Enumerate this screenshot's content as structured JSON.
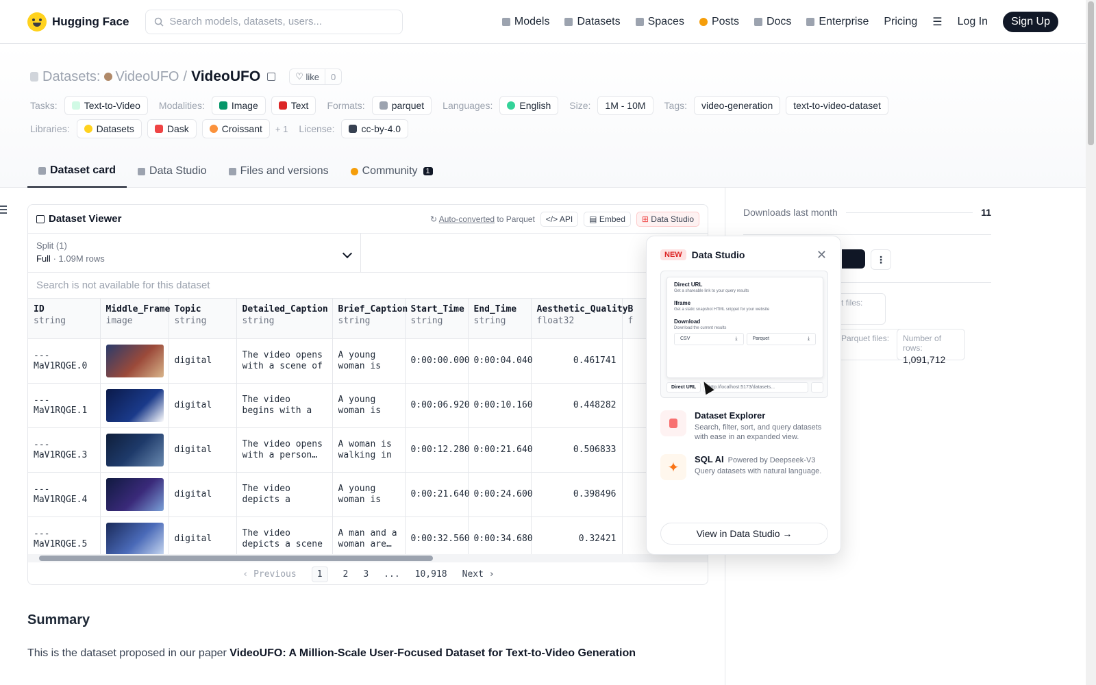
{
  "nav": {
    "brand": "Hugging Face",
    "search_placeholder": "Search models, datasets, users...",
    "links": [
      "Models",
      "Datasets",
      "Spaces",
      "Posts",
      "Docs",
      "Enterprise",
      "Pricing"
    ],
    "login": "Log In",
    "signup": "Sign Up"
  },
  "header": {
    "section_label": "Datasets:",
    "owner": "VideoUFO",
    "separator": "/",
    "name": "VideoUFO",
    "like_label": "like",
    "like_count": "0",
    "tasks_label": "Tasks:",
    "task": "Text-to-Video",
    "modalities_label": "Modalities:",
    "modality_image": "Image",
    "modality_text": "Text",
    "formats_label": "Formats:",
    "format": "parquet",
    "languages_label": "Languages:",
    "language": "English",
    "size_label": "Size:",
    "size": "1M - 10M",
    "tags_label": "Tags:",
    "tag1": "video-generation",
    "tag2": "text-to-video-dataset",
    "libraries_label": "Libraries:",
    "lib1": "Datasets",
    "lib2": "Dask",
    "lib3": "Croissant",
    "lib_more": "+ 1",
    "license_label": "License:",
    "license": "cc-by-4.0",
    "tabs": [
      {
        "label": "Dataset card"
      },
      {
        "label": "Data Studio"
      },
      {
        "label": "Files and versions"
      },
      {
        "label": "Community",
        "badge": "1"
      }
    ]
  },
  "viewer": {
    "title": "Dataset Viewer",
    "auto_converted": "Auto-converted",
    "to_parquet": "to Parquet",
    "api": "API",
    "embed": "Embed",
    "data_studio": "Data Studio",
    "split_label": "Split (1)",
    "split_name": "Full",
    "split_sep": "·",
    "split_rows": "1.09M rows",
    "search_disabled": "Search is not available for this dataset",
    "columns": [
      {
        "name": "ID",
        "type": "string"
      },
      {
        "name": "Middle_Frame",
        "type": "image"
      },
      {
        "name": "Topic",
        "type": "string"
      },
      {
        "name": "Detailed_Caption",
        "type": "string"
      },
      {
        "name": "Brief_Caption",
        "type": "string"
      },
      {
        "name": "Start_Time",
        "type": "string"
      },
      {
        "name": "End_Time",
        "type": "string"
      },
      {
        "name": "Aesthetic_Quality",
        "type": "float32"
      },
      {
        "name": "B",
        "type": "f"
      }
    ],
    "rows": [
      {
        "id": "---MaV1RQGE.0",
        "topic": "digital",
        "detailed": "The video opens with a scene of a…",
        "brief": "A young woman is sitting a…",
        "start": "0:00:00.000",
        "end": "0:00:04.040",
        "aq": "0.461741"
      },
      {
        "id": "---MaV1RQGE.1",
        "topic": "digital",
        "detailed": "The video begins with a person…",
        "brief": "A young woman is sitting a…",
        "start": "0:00:06.920",
        "end": "0:00:10.160",
        "aq": "0.448282"
      },
      {
        "id": "---MaV1RQGE.3",
        "topic": "digital",
        "detailed": "The video opens with a person…",
        "brief": "A woman is walking in a…",
        "start": "0:00:12.280",
        "end": "0:00:21.640",
        "aq": "0.506833"
      },
      {
        "id": "---MaV1RQGE.4",
        "topic": "digital",
        "detailed": "The video depicts a person standing…",
        "brief": "A young woman is walking i…",
        "start": "0:00:21.640",
        "end": "0:00:24.600",
        "aq": "0.398496"
      },
      {
        "id": "---MaV1RQGE.5",
        "topic": "digital",
        "detailed": "The video depicts a scene in a diml…",
        "brief": "A man and a woman are…",
        "start": "0:00:32.560",
        "end": "0:00:34.680",
        "aq": "0.32421"
      }
    ],
    "pager": {
      "previous": "Previous",
      "pages": [
        "1",
        "2",
        "3",
        "...",
        "10,918"
      ],
      "next": "Next"
    }
  },
  "summary": {
    "heading": "Summary",
    "text": "This is the dataset proposed in our paper ",
    "paper": "VideoUFO: A Million-Scale User-Focused Dataset for Text-to-Video Generation"
  },
  "sidebar": {
    "downloads_label": "Downloads last month",
    "downloads_value": "11",
    "partial_files_label": "t files:",
    "parquet_files_label": "Parquet files:",
    "rows_label": "Number of rows:",
    "rows_value": "1,091,712"
  },
  "popover": {
    "badge": "NEW",
    "title": "Data Studio",
    "preview": {
      "direct_url": "Direct URL",
      "direct_url_desc": "Get a shareable link to your query results",
      "iframe": "Iframe",
      "iframe_desc": "Get a static snapshot HTML snippet for your website",
      "download": "Download",
      "download_desc": "Download the current results",
      "csv": "CSV",
      "parquet": "Parquet",
      "url_btn": "Direct URL",
      "url": "http://localhost:5173/datasets..."
    },
    "explorer_title": "Dataset Explorer",
    "explorer_desc": "Search, filter, sort, and query datasets with ease in an expanded view.",
    "sql_title": "SQL AI",
    "sql_powered": "Powered by Deepseek-V3",
    "sql_desc": "Query datasets with natural language.",
    "view_button": "View in Data Studio →"
  }
}
